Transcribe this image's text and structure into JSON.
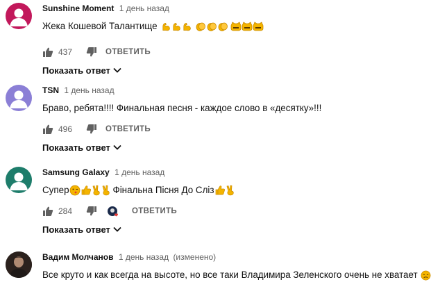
{
  "comments": [
    {
      "author": "Sunshine Moment",
      "time": "1 день назад",
      "edited": "",
      "text": "Жека Кошевой Талантище",
      "text_after": "",
      "likes": "437",
      "reply_label": "ОТВЕТИТЬ",
      "show_replies": "Показать ответ",
      "avatar_color": "#c2185b",
      "emoji": [
        "flexed-biceps-icon",
        "flexed-biceps-icon",
        "flexed-biceps-icon",
        "clapping-hands-icon",
        "clapping-hands-icon",
        "clapping-hands-icon",
        "cat-face-icon",
        "cat-face-icon",
        "cat-face-icon"
      ]
    },
    {
      "author": "TSN",
      "time": "1 день назад",
      "edited": "",
      "text": "Браво, ребята!!!! Финальная песня - каждое слово в «десятку»!!!",
      "text_after": "",
      "likes": "496",
      "reply_label": "ОТВЕТИТЬ",
      "show_replies": "Показать ответ",
      "avatar_color": "#8b7fd6"
    },
    {
      "author": "Samsung Galaxy",
      "time": "1 день назад",
      "edited": "",
      "text": "Супер",
      "text_after": "Фінальна Пісня До Сліз",
      "likes": "284",
      "reply_label": "ОТВЕТИТЬ",
      "show_replies": "Показать ответ",
      "avatar_color": "#1e7d6b"
    },
    {
      "author": "Вадим Молчанов",
      "time": "1 день назад",
      "edited": "(изменено)",
      "text": "Все круто и как всегда на высоте, но все таки Владимира Зеленского очень не хватает",
      "text_after": "",
      "avatar_color": "#3a2e2a"
    }
  ]
}
